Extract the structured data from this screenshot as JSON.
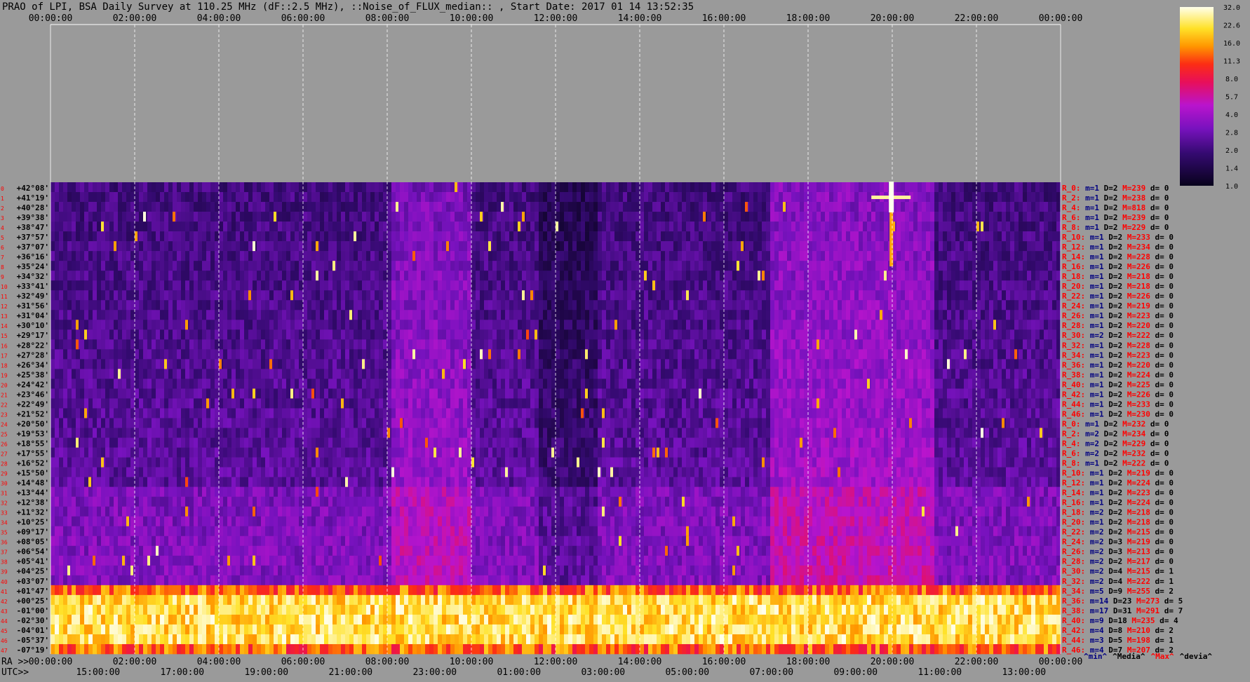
{
  "title": "PRAO of LPI, BSA Daily Survey at 110.25 MHz (dF::2.5 MHz), ::Noise_of_FLUX_median:: , Start Date: 2017 01 14 13:52:35",
  "colors": {
    "background": "#9a9a9a",
    "text": "#000000",
    "axis_grid": "#ffffff",
    "stat_label": "#ff0000",
    "stat_min": "#000080"
  },
  "chart_data": {
    "type": "heatmap",
    "title": "PRAO of LPI, BSA Daily Survey at 110.25 MHz (dF::2.5 MHz), ::Noise_of_FLUX_median:: , Start Date: 2017 01 14 13:52:35",
    "x_top_ticks": [
      "00:00:00",
      "02:00:00",
      "04:00:00",
      "06:00:00",
      "08:00:00",
      "10:00:00",
      "12:00:00",
      "14:00:00",
      "16:00:00",
      "18:00:00",
      "20:00:00",
      "22:00:00",
      "00:00:00"
    ],
    "x_bottom": {
      "ra_label": "RA >>",
      "utc_label": "UTC>>",
      "ra_ticks": [
        "00:00:00",
        "02:00:00",
        "04:00:00",
        "06:00:00",
        "08:00:00",
        "10:00:00",
        "12:00:00",
        "14:00:00",
        "16:00:00",
        "18:00:00",
        "20:00:00",
        "22:00:00",
        "00:00:00"
      ],
      "utc_ticks": [
        "15:00:00",
        "17:00:00",
        "19:00:00",
        "21:00:00",
        "23:00:00",
        "01:00:00",
        "03:00:00",
        "05:00:00",
        "07:00:00",
        "09:00:00",
        "11:00:00",
        "13:00:00"
      ]
    },
    "y_labels": [
      "+42°08'",
      "+41°19'",
      "+40°28'",
      "+39°38'",
      "+38°47'",
      "+37°57'",
      "+37°07'",
      "+36°16'",
      "+35°24'",
      "+34°32'",
      "+33°41'",
      "+32°49'",
      "+31°56'",
      "+31°04'",
      "+30°10'",
      "+29°17'",
      "+28°22'",
      "+27°28'",
      "+26°34'",
      "+25°38'",
      "+24°42'",
      "+23°46'",
      "+22°49'",
      "+21°52'",
      "+20°50'",
      "+19°53'",
      "+18°55'",
      "+17°55'",
      "+16°52'",
      "+15°50'",
      "+14°48'",
      "+13°44'",
      "+12°38'",
      "+11°32'",
      "+10°25'",
      "+09°17'",
      "+08°05'",
      "+06°54'",
      "+05°41'",
      "+04°25'",
      "+03°07'",
      "+01°47'",
      "+00°25'",
      "-01°00'",
      "-02°30'",
      "-04°01'",
      "-05°37'",
      "-07°19'"
    ],
    "colorbar": {
      "ticks": [
        "32.0",
        "22.6",
        "16.0",
        "11.3",
        "8.0",
        "5.7",
        "4.0",
        "2.8",
        "2.0",
        "1.4",
        "1.0"
      ],
      "scale": "log",
      "min": 1.0,
      "max": 32.0
    },
    "stats": [
      {
        "label": "R_0:",
        "m": "1",
        "D": "2",
        "M": "239",
        "d": "0"
      },
      {
        "label": "R_2:",
        "m": "1",
        "D": "2",
        "M": "238",
        "d": "0"
      },
      {
        "label": "R_4:",
        "m": "1",
        "D": "2",
        "M": "818",
        "d": "0"
      },
      {
        "label": "R_6:",
        "m": "1",
        "D": "2",
        "M": "239",
        "d": "0"
      },
      {
        "label": "R_8:",
        "m": "1",
        "D": "2",
        "M": "229",
        "d": "0"
      },
      {
        "label": "R_10:",
        "m": "1",
        "D": "2",
        "M": "233",
        "d": "0"
      },
      {
        "label": "R_12:",
        "m": "1",
        "D": "2",
        "M": "234",
        "d": "0"
      },
      {
        "label": "R_14:",
        "m": "1",
        "D": "2",
        "M": "228",
        "d": "0"
      },
      {
        "label": "R_16:",
        "m": "1",
        "D": "2",
        "M": "226",
        "d": "0"
      },
      {
        "label": "R_18:",
        "m": "1",
        "D": "2",
        "M": "218",
        "d": "0"
      },
      {
        "label": "R_20:",
        "m": "1",
        "D": "2",
        "M": "218",
        "d": "0"
      },
      {
        "label": "R_22:",
        "m": "1",
        "D": "2",
        "M": "226",
        "d": "0"
      },
      {
        "label": "R_24:",
        "m": "1",
        "D": "2",
        "M": "219",
        "d": "0"
      },
      {
        "label": "R_26:",
        "m": "1",
        "D": "2",
        "M": "223",
        "d": "0"
      },
      {
        "label": "R_28:",
        "m": "1",
        "D": "2",
        "M": "220",
        "d": "0"
      },
      {
        "label": "R_30:",
        "m": "2",
        "D": "2",
        "M": "222",
        "d": "0"
      },
      {
        "label": "R_32:",
        "m": "1",
        "D": "2",
        "M": "228",
        "d": "0"
      },
      {
        "label": "R_34:",
        "m": "1",
        "D": "2",
        "M": "223",
        "d": "0"
      },
      {
        "label": "R_36:",
        "m": "1",
        "D": "2",
        "M": "220",
        "d": "0"
      },
      {
        "label": "R_38:",
        "m": "1",
        "D": "2",
        "M": "224",
        "d": "0"
      },
      {
        "label": "R_40:",
        "m": "1",
        "D": "2",
        "M": "225",
        "d": "0"
      },
      {
        "label": "R_42:",
        "m": "1",
        "D": "2",
        "M": "226",
        "d": "0"
      },
      {
        "label": "R_44:",
        "m": "1",
        "D": "2",
        "M": "233",
        "d": "0"
      },
      {
        "label": "R_46:",
        "m": "1",
        "D": "2",
        "M": "230",
        "d": "0"
      },
      {
        "label": "R_0:",
        "m": "1",
        "D": "2",
        "M": "232",
        "d": "0"
      },
      {
        "label": "R_2:",
        "m": "2",
        "D": "2",
        "M": "234",
        "d": "0"
      },
      {
        "label": "R_4:",
        "m": "2",
        "D": "2",
        "M": "229",
        "d": "0"
      },
      {
        "label": "R_6:",
        "m": "2",
        "D": "2",
        "M": "232",
        "d": "0"
      },
      {
        "label": "R_8:",
        "m": "1",
        "D": "2",
        "M": "222",
        "d": "0"
      },
      {
        "label": "R_10:",
        "m": "1",
        "D": "2",
        "M": "219",
        "d": "0"
      },
      {
        "label": "R_12:",
        "m": "1",
        "D": "2",
        "M": "224",
        "d": "0"
      },
      {
        "label": "R_14:",
        "m": "1",
        "D": "2",
        "M": "223",
        "d": "0"
      },
      {
        "label": "R_16:",
        "m": "1",
        "D": "2",
        "M": "224",
        "d": "0"
      },
      {
        "label": "R_18:",
        "m": "2",
        "D": "2",
        "M": "218",
        "d": "0"
      },
      {
        "label": "R_20:",
        "m": "1",
        "D": "2",
        "M": "218",
        "d": "0"
      },
      {
        "label": "R_22:",
        "m": "2",
        "D": "2",
        "M": "215",
        "d": "0"
      },
      {
        "label": "R_24:",
        "m": "2",
        "D": "3",
        "M": "219",
        "d": "0"
      },
      {
        "label": "R_26:",
        "m": "2",
        "D": "3",
        "M": "213",
        "d": "0"
      },
      {
        "label": "R_28:",
        "m": "2",
        "D": "2",
        "M": "217",
        "d": "0"
      },
      {
        "label": "R_30:",
        "m": "2",
        "D": "4",
        "M": "215",
        "d": "1"
      },
      {
        "label": "R_32:",
        "m": "2",
        "D": "4",
        "M": "222",
        "d": "1"
      },
      {
        "label": "R_34:",
        "m": "5",
        "D": "9",
        "M": "255",
        "d": "2"
      },
      {
        "label": "R_36:",
        "m": "14",
        "D": "23",
        "M": "273",
        "d": "5"
      },
      {
        "label": "R_38:",
        "m": "17",
        "D": "31",
        "M": "291",
        "d": "7"
      },
      {
        "label": "R_40:",
        "m": "9",
        "D": "18",
        "M": "235",
        "d": "4"
      },
      {
        "label": "R_42:",
        "m": "4",
        "D": "8",
        "M": "210",
        "d": "2"
      },
      {
        "label": "R_44:",
        "m": "3",
        "D": "5",
        "M": "198",
        "d": "1"
      },
      {
        "label": "R_46:",
        "m": "4",
        "D": "7",
        "M": "207",
        "d": "2"
      }
    ],
    "stat_footer": [
      "^min^",
      "^Media^",
      "^Max^",
      "^devia^"
    ],
    "features": {
      "galactic_plane_rows": [
        41,
        42,
        43,
        44,
        45,
        46,
        47
      ],
      "bright_source": {
        "ra_hours": 19.97,
        "dec_row": 1
      }
    }
  }
}
